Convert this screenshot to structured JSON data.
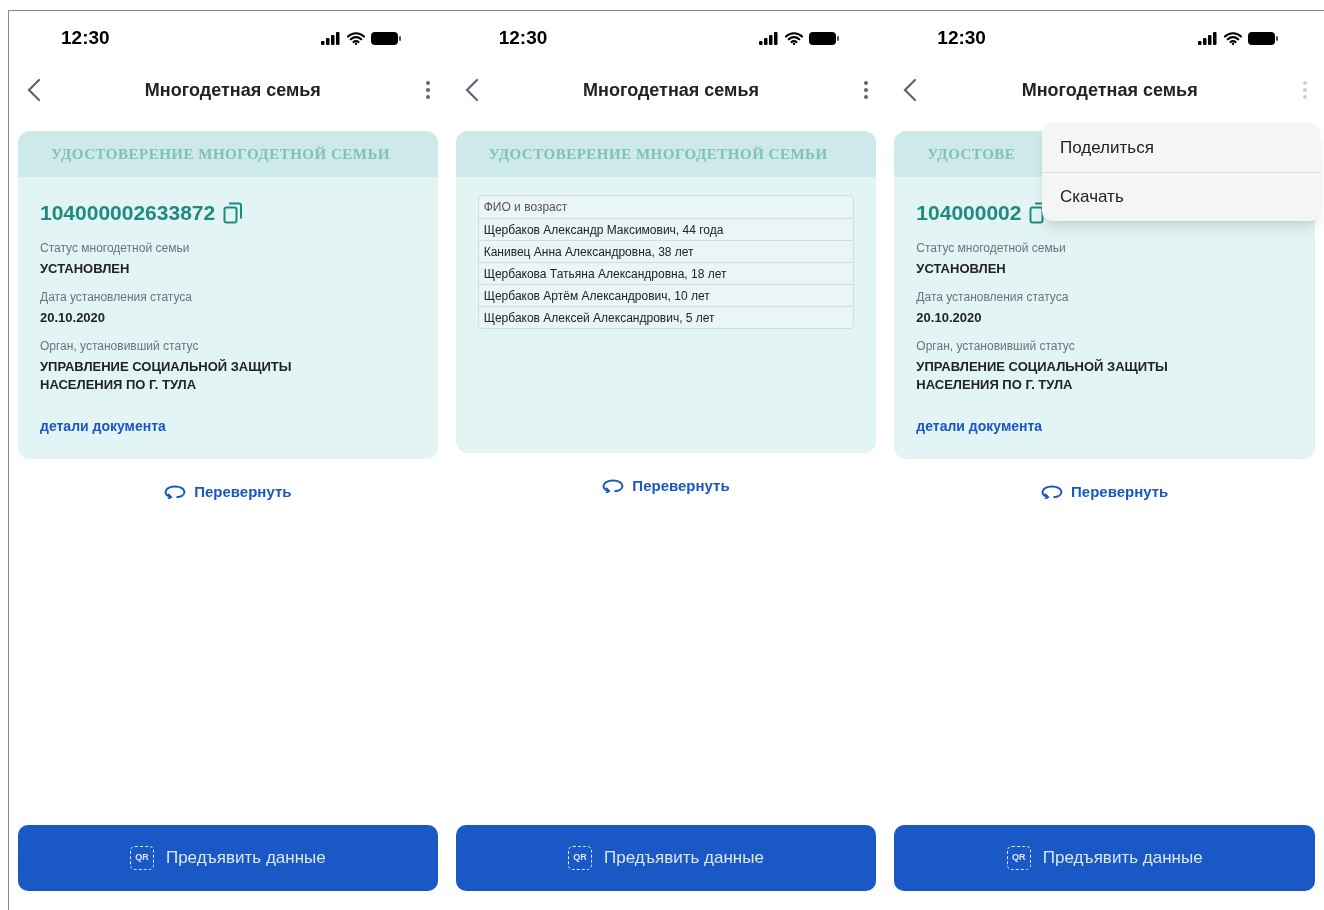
{
  "screens": [
    {
      "kind": "front",
      "time": "12:30",
      "title": "Многодетная семья",
      "card_title": "УДОСТОВЕРЕНИЕ МНОГОДЕТНОЙ СЕМЬИ",
      "number": "104000002633872",
      "fields": [
        {
          "label": "Статус многодетной семьи",
          "value": "УСТАНОВЛЕН"
        },
        {
          "label": "Дата установления статуса",
          "value": "20.10.2020"
        },
        {
          "label": "Орган, установивший статус",
          "value": "УПРАВЛЕНИЕ СОЦИАЛЬНОЙ ЗАЩИТЫ НАСЕЛЕНИЯ ПО Г. ТУЛА"
        }
      ],
      "link": "детали документа",
      "flip": "Перевернуть",
      "qr_label": "QR",
      "button": "Предъявить данные"
    },
    {
      "kind": "back",
      "time": "12:30",
      "title": "Многодетная семья",
      "card_title": "УДОСТОВЕРЕНИЕ МНОГОДЕТНОЙ СЕМЬИ",
      "table": {
        "header": "ФИО и возраст",
        "rows": [
          "Щербаков Александр Максимович, 44 года",
          "Канивец Анна Александровна, 38 лет",
          "Щербакова Татьяна Александровна, 18 лет",
          "Щербаков Артём Александрович, 10 лет",
          "Щербаков Алексей Александрович, 5 лет"
        ]
      },
      "flip": "Перевернуть",
      "qr_label": "QR",
      "button": "Предъявить данные"
    },
    {
      "kind": "front",
      "time": "12:30",
      "title": "Многодетная семья",
      "card_title": "УДОСТОВЕ",
      "number": "104000002",
      "fields": [
        {
          "label": "Статус многодетной семьи",
          "value": "УСТАНОВЛЕН"
        },
        {
          "label": "Дата установления статуса",
          "value": "20.10.2020"
        },
        {
          "label": "Орган, установивший статус",
          "value": "УПРАВЛЕНИЕ СОЦИАЛЬНОЙ ЗАЩИТЫ НАСЕЛЕНИЯ ПО Г. ТУЛА"
        }
      ],
      "link": "детали документа",
      "flip": "Перевернуть",
      "qr_label": "QR",
      "button": "Предъявить данные",
      "menu": [
        "Поделиться",
        "Скачать"
      ]
    }
  ]
}
